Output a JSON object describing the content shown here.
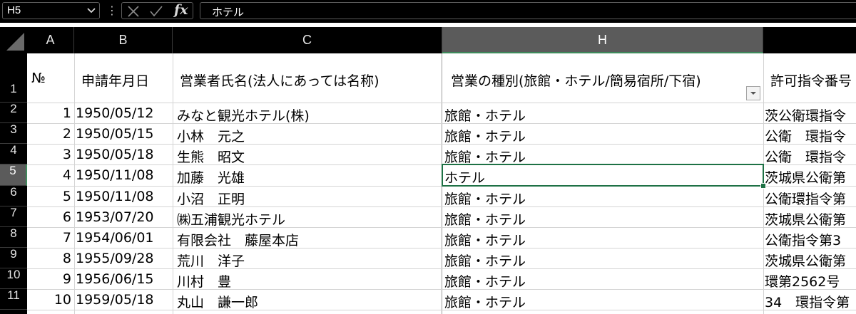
{
  "formula_bar": {
    "name_box": "H5",
    "fx_label": "fx",
    "separator": "⋮",
    "content": "ホテル"
  },
  "columns": [
    "A",
    "B",
    "C",
    "H"
  ],
  "header_row": {
    "row_number": "1",
    "A": "№",
    "B": "申請年月日",
    "C": "営業者氏名(法人にあっては名称)",
    "H": "営業の種別(旅館・ホテル/簡易宿所/下宿)",
    "I": "許可指令番号"
  },
  "rows": [
    {
      "row": "2",
      "A": "1",
      "B": "1950/05/12",
      "C": "みなと観光ホテル(株)",
      "H": "旅館・ホテル",
      "I": "茨公衛環指令"
    },
    {
      "row": "3",
      "A": "2",
      "B": "1950/05/15",
      "C": "小林　元之",
      "H": "旅館・ホテル",
      "I": "公衛　環指令"
    },
    {
      "row": "4",
      "A": "3",
      "B": "1950/05/18",
      "C": "生熊　昭文",
      "H": "旅館・ホテル",
      "I": "公衛　環指令"
    },
    {
      "row": "5",
      "A": "4",
      "B": "1950/11/08",
      "C": "加藤　光雄",
      "H": "ホテル",
      "I": "茨城県公衛第"
    },
    {
      "row": "6",
      "A": "5",
      "B": "1950/11/08",
      "C": "小沼　正明",
      "H": "旅館・ホテル",
      "I": "公衛環指令第"
    },
    {
      "row": "7",
      "A": "6",
      "B": "1953/07/20",
      "C": "㈱五浦観光ホテル",
      "H": "旅館・ホテル",
      "I": "茨城県公衛第"
    },
    {
      "row": "8",
      "A": "7",
      "B": "1954/06/01",
      "C": "有限会社　藤屋本店",
      "H": "旅館・ホテル",
      "I": "公衛指令第3"
    },
    {
      "row": "9",
      "A": "8",
      "B": "1955/09/28",
      "C": "荒川　洋子",
      "H": "旅館・ホテル",
      "I": "茨城県公衛第"
    },
    {
      "row": "10",
      "A": "9",
      "B": "1956/06/15",
      "C": "川村　豊",
      "H": "旅館・ホテル",
      "I": "環第2562号"
    },
    {
      "row": "11",
      "A": "10",
      "B": "1959/05/18",
      "C": "丸山　謙一郎",
      "H": "旅館・ホテル",
      "I": "34　環指令第"
    }
  ],
  "colors": {
    "selection_green": "#1e7145",
    "header_bg": "#000000",
    "selected_header_bg": "#5b5b5b"
  }
}
